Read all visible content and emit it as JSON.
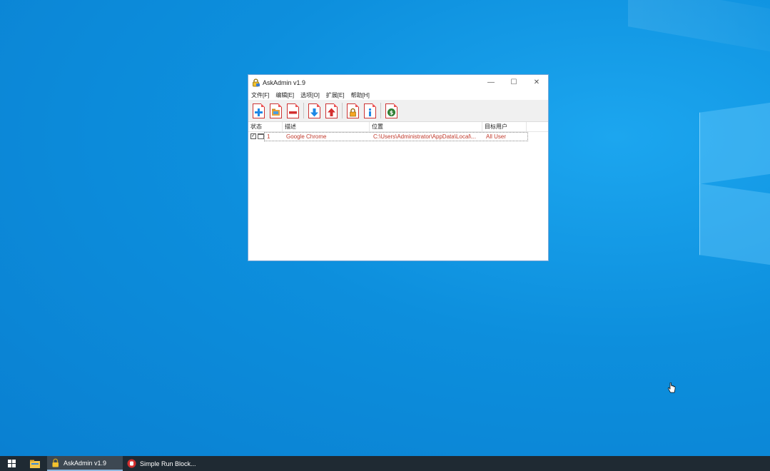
{
  "window": {
    "title": "AskAdmin v1.9",
    "minimize_glyph": "—",
    "maximize_glyph": "☐",
    "close_glyph": "✕",
    "icon": "padlock-shield-icon"
  },
  "menu": [
    {
      "label": "文件[F]"
    },
    {
      "label": "编辑[E]"
    },
    {
      "label": "选项[O]"
    },
    {
      "label": "扩展[E]"
    },
    {
      "label": "帮助[H]"
    }
  ],
  "toolbar": [
    {
      "icon": "add-icon",
      "color": "#1e88e5"
    },
    {
      "icon": "folder-icon",
      "color": "#e8a33d"
    },
    {
      "icon": "remove-icon",
      "color": "#d32f2f"
    },
    {
      "icon": "import-icon",
      "color": "#1e88e5"
    },
    {
      "icon": "export-icon",
      "color": "#d32f2f"
    },
    {
      "icon": "lock-icon",
      "color": "#f5a623"
    },
    {
      "icon": "info-icon",
      "color": "#1e88e5"
    },
    {
      "icon": "donate-icon",
      "color": "#2e7d32"
    }
  ],
  "list": {
    "columns": [
      "状态",
      "描述",
      "位置",
      "目标用户"
    ],
    "rows": [
      {
        "checked": true,
        "index": "1",
        "description": "Google Chrome",
        "location": "C:\\Users\\Administrator\\AppData\\Local\\...",
        "target_user": "All User"
      }
    ]
  },
  "taskbar": {
    "tasks": [
      {
        "label": "AskAdmin v1.9",
        "icon": "askadmin-icon",
        "active": true
      },
      {
        "label": "Simple Run Block...",
        "icon": "stop-hand-icon",
        "active": false
      }
    ]
  },
  "colors": {
    "desktop": "#0d8fdd",
    "row_text": "#c0392b",
    "taskbar": "#1f2a33"
  }
}
